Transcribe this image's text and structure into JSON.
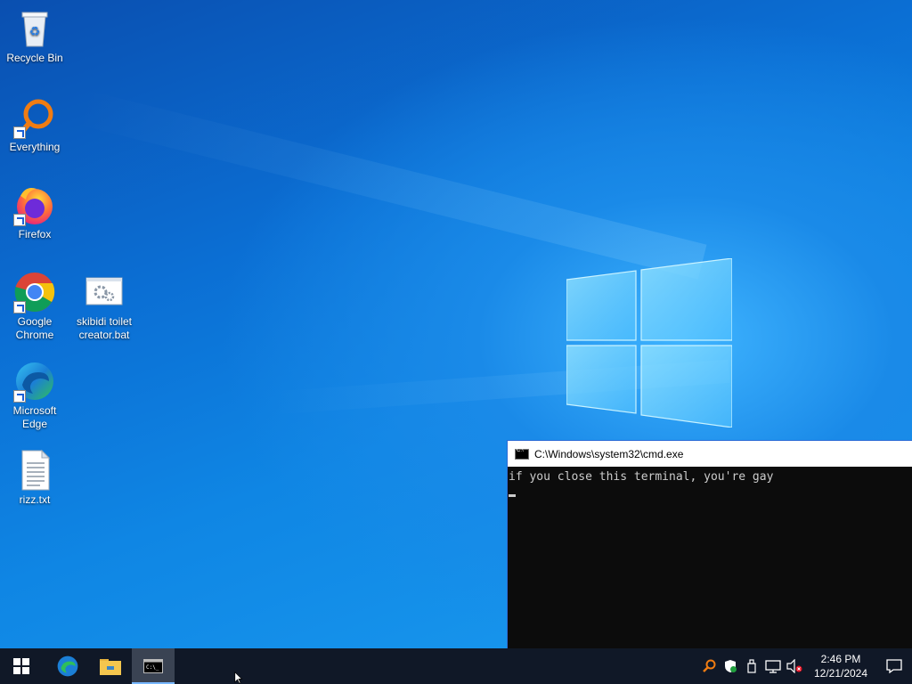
{
  "desktop": {
    "icons": [
      {
        "label": "Recycle Bin",
        "icon": "recycle-bin-icon"
      },
      {
        "label": "Everything",
        "icon": "everything-search-icon"
      },
      {
        "label": "Firefox",
        "icon": "firefox-icon"
      },
      {
        "label": "Google Chrome",
        "icon": "chrome-icon"
      },
      {
        "label": "skibidi toilet creator.bat",
        "icon": "batch-file-icon"
      },
      {
        "label": "Microsoft Edge",
        "icon": "edge-icon"
      },
      {
        "label": "rizz.txt",
        "icon": "text-file-icon"
      }
    ]
  },
  "cmd": {
    "title": "C:\\Windows\\system32\\cmd.exe",
    "output_line": "if you close this terminal, you're gay"
  },
  "taskbar": {
    "items": [
      "start-icon",
      "edge-icon",
      "file-explorer-icon",
      "cmd-icon"
    ],
    "tray": {
      "time": "2:46 PM",
      "date": "12/21/2024",
      "icons": [
        "everything-tray-icon",
        "windows-security-icon",
        "usb-device-icon",
        "network-icon",
        "volume-muted-icon",
        "notification-center-icon"
      ]
    }
  },
  "colors": {
    "taskbar": "#101827",
    "desktop_accent": "#0b6fd4",
    "cmd_bg": "#0c0c0c"
  }
}
